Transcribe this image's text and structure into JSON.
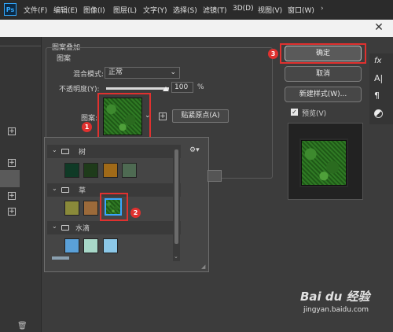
{
  "app": {
    "logo": "Ps"
  },
  "menu": [
    "文件(F)",
    "编辑(E)",
    "图像(I)",
    "图层(L)",
    "文字(Y)",
    "选择(S)",
    "滤镜(T)",
    "3D(D)",
    "视图(V)",
    "窗口(W)"
  ],
  "dialog": {
    "section_title": "图案叠加",
    "group_title": "图案",
    "blend_label": "混合模式:",
    "blend_value": "正常",
    "opacity_label": "不透明度(Y):",
    "opacity_value": "100",
    "opacity_unit": "%",
    "opacity_level": 1.0,
    "pattern_label": "图案:",
    "snap_button": "贴紧原点(A)"
  },
  "popup": {
    "groups": [
      {
        "name": "树",
        "count": 4
      },
      {
        "name": "草",
        "count": 3,
        "selected_index": 2
      },
      {
        "name": "水滴",
        "count": 3
      }
    ]
  },
  "buttons": {
    "ok": "确定",
    "cancel": "取消",
    "new_style": "新建样式(W)...",
    "preview": "预览(V)"
  },
  "badges": {
    "one": "1",
    "two": "2",
    "three": "3"
  },
  "colors": {
    "accent_red": "#e0312f",
    "selection_blue": "#3aa6ff",
    "grass_green": "#2f7a24"
  },
  "watermark": {
    "brand": "Bai du 经验",
    "url": "jingyan.baidu.com"
  }
}
